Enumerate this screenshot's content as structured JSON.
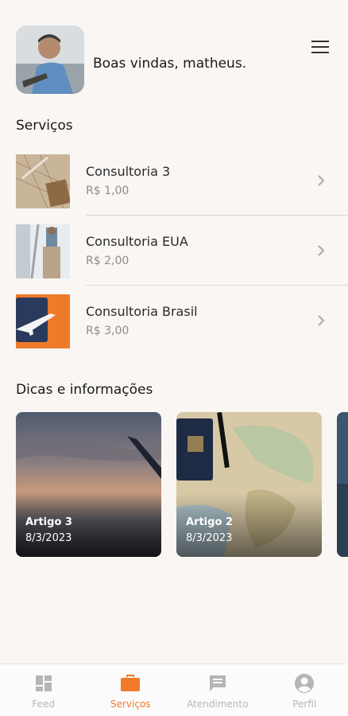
{
  "header": {
    "welcome": "Boas vindas, matheus.",
    "menu_icon": "hamburger-menu-icon"
  },
  "services": {
    "title": "Serviços",
    "items": [
      {
        "name": "Consultoria 3",
        "price": "R$ 1,00"
      },
      {
        "name": "Consultoria EUA",
        "price": "R$ 2,00"
      },
      {
        "name": "Consultoria Brasil",
        "price": "R$ 3,00"
      }
    ]
  },
  "tips": {
    "title": "Dicas e informações",
    "cards": [
      {
        "title": "Artigo 3",
        "date": "8/3/2023"
      },
      {
        "title": "Artigo 2",
        "date": "8/3/2023"
      }
    ]
  },
  "nav": {
    "items": [
      {
        "label": "Feed",
        "icon": "dashboard-icon"
      },
      {
        "label": "Serviços",
        "icon": "briefcase-icon"
      },
      {
        "label": "Atendimento",
        "icon": "chat-icon"
      },
      {
        "label": "Perfil",
        "icon": "account-icon"
      }
    ],
    "active_color": "#f07b2b",
    "inactive_color": "#b5b5b5"
  }
}
